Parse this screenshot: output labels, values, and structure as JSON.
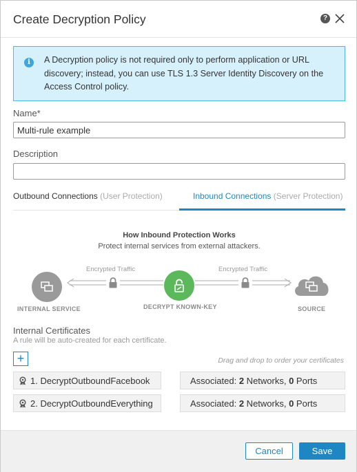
{
  "dialog": {
    "title": "Create Decryption Policy",
    "help_icon": "help-icon",
    "close_icon": "close-icon"
  },
  "info": {
    "icon": "info-icon",
    "text": "A Decryption policy is not required only to perform application or URL discovery; instead, you can use TLS 1.3 Server Identity Discovery on the Access Control policy."
  },
  "name_field": {
    "label": "Name*",
    "value": "Multi-rule example"
  },
  "description_field": {
    "label": "Description",
    "value": ""
  },
  "tabs": [
    {
      "label": "Outbound Connections",
      "sub": "(User Protection)",
      "active": false
    },
    {
      "label": "Inbound Connections",
      "sub": "(Server Protection)",
      "active": true
    }
  ],
  "how_it_works": {
    "title": "How Inbound Protection Works",
    "subtitle": "Protect internal services from external attackers.",
    "left_label": "Encrypted Traffic",
    "right_label": "Encrypted Traffic",
    "node_internal": "INTERNAL SERVICE",
    "node_decrypt": "DECRYPT KNOWN-KEY",
    "node_source": "SOURCE"
  },
  "certificates": {
    "title": "Internal Certificates",
    "subtitle": "A rule will be auto-created for each certificate.",
    "drag_hint": "Drag and drop to order your certificates",
    "add_icon": "plus-icon",
    "items": [
      {
        "name": "1. DecryptOutboundFacebook",
        "assoc_prefix": "Associated: ",
        "networks": "2",
        "networks_label": " Networks, ",
        "ports": "0",
        "ports_label": " Ports"
      },
      {
        "name": "2. DecryptOutboundEverything",
        "assoc_prefix": "Associated: ",
        "networks": "2",
        "networks_label": " Networks, ",
        "ports": "0",
        "ports_label": " Ports"
      }
    ]
  },
  "footer": {
    "cancel_label": "Cancel",
    "save_label": "Save"
  },
  "colors": {
    "accent": "#1e86c2",
    "info_bg": "#d6f1fb",
    "info_border": "#4fb8de",
    "decrypt_green": "#5bb85b",
    "node_gray": "#9a9a9a"
  }
}
